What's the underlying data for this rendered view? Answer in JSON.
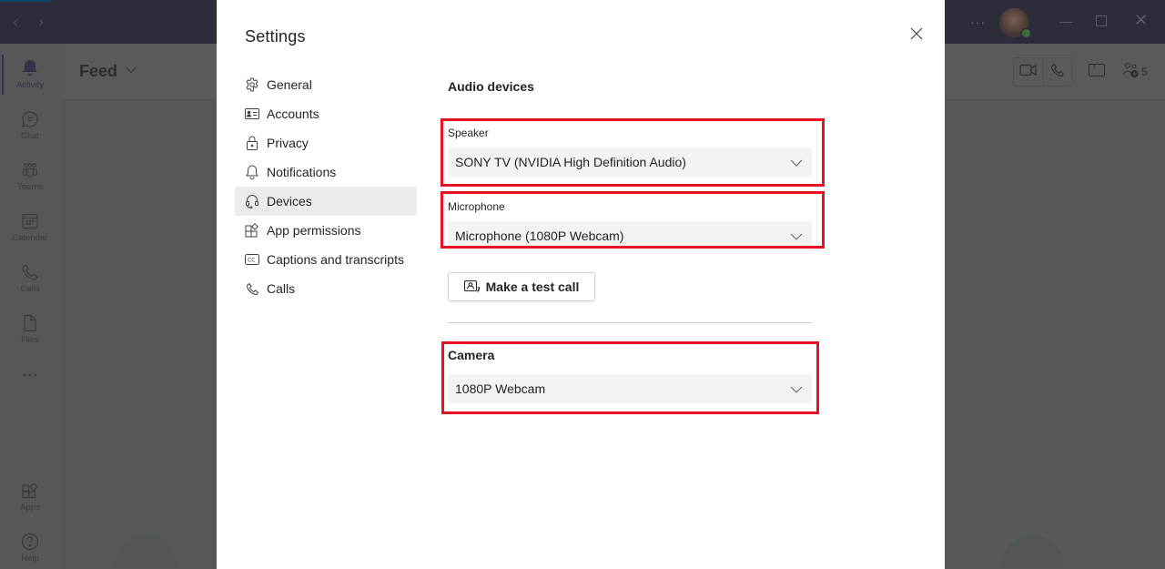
{
  "titlebar": {
    "nav_back_glyph": "‹",
    "nav_forward_glyph": "›",
    "more_glyph": "···",
    "close_glyph": "✕"
  },
  "rail": {
    "items": [
      {
        "label": "Activity",
        "icon": "bell-icon",
        "active": true
      },
      {
        "label": "Chat",
        "icon": "chat-icon"
      },
      {
        "label": "Teams",
        "icon": "teams-icon"
      },
      {
        "label": "Calendar",
        "icon": "calendar-icon"
      },
      {
        "label": "Calls",
        "icon": "phone-icon"
      },
      {
        "label": "Files",
        "icon": "file-icon"
      },
      {
        "label": "",
        "icon": "more-icon"
      },
      {
        "label": "Apps",
        "icon": "apps-icon"
      },
      {
        "label": "Help",
        "icon": "help-icon"
      }
    ]
  },
  "feed": {
    "title": "Feed",
    "people_count": "5"
  },
  "settings": {
    "title": "Settings",
    "nav": [
      {
        "label": "General",
        "icon": "gear-icon"
      },
      {
        "label": "Accounts",
        "icon": "id-card-icon"
      },
      {
        "label": "Privacy",
        "icon": "lock-icon"
      },
      {
        "label": "Notifications",
        "icon": "bell-icon"
      },
      {
        "label": "Devices",
        "icon": "headset-icon",
        "selected": true
      },
      {
        "label": "App permissions",
        "icon": "apps-icon"
      },
      {
        "label": "Captions and transcripts",
        "icon": "cc-icon"
      },
      {
        "label": "Calls",
        "icon": "phone-icon"
      }
    ],
    "devices": {
      "audio_title": "Audio devices",
      "speaker_label": "Speaker",
      "speaker_value": "SONY TV (NVIDIA High Definition Audio)",
      "microphone_label": "Microphone",
      "microphone_value": "Microphone (1080P Webcam)",
      "test_call_label": "Make a test call",
      "camera_title": "Camera",
      "camera_value": "1080P Webcam"
    }
  },
  "colors": {
    "highlight": "#e81123",
    "selected_nav": "#ebebeb",
    "dropdown_bg": "#f3f3f3"
  }
}
